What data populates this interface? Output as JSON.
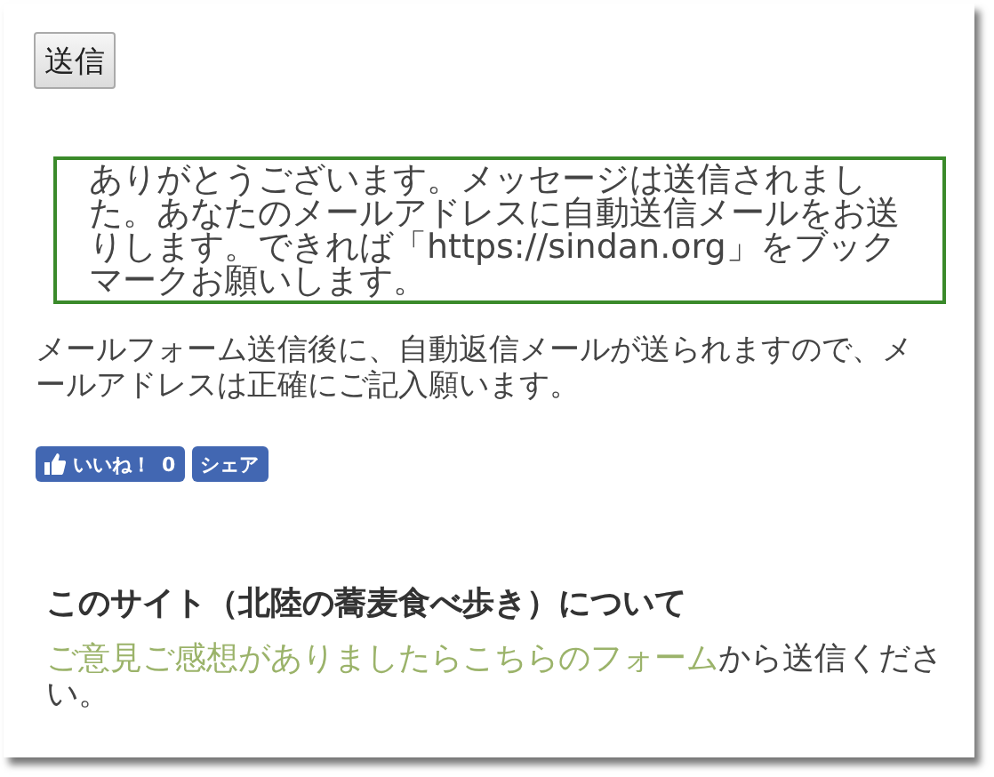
{
  "submit_button": "送信",
  "message": "ありがとうございます。メッセージは送信されました。あなたのメールアドレスに自動送信メールをお送りします。できれば「https://sindan.org」をブックマークお願いします。",
  "notice": "メールフォーム送信後に、自動返信メールが送られますので、メールアドレスは正確にご記入願います。",
  "social": {
    "like_label": "いいね！",
    "like_count": "0",
    "share_label": "シェア"
  },
  "about": {
    "heading": "このサイト（北陸の蕎麦食べ歩き）について",
    "link": "ご意見ご感想がありましたらこちらのフォーム",
    "text": "から送信ください。"
  }
}
